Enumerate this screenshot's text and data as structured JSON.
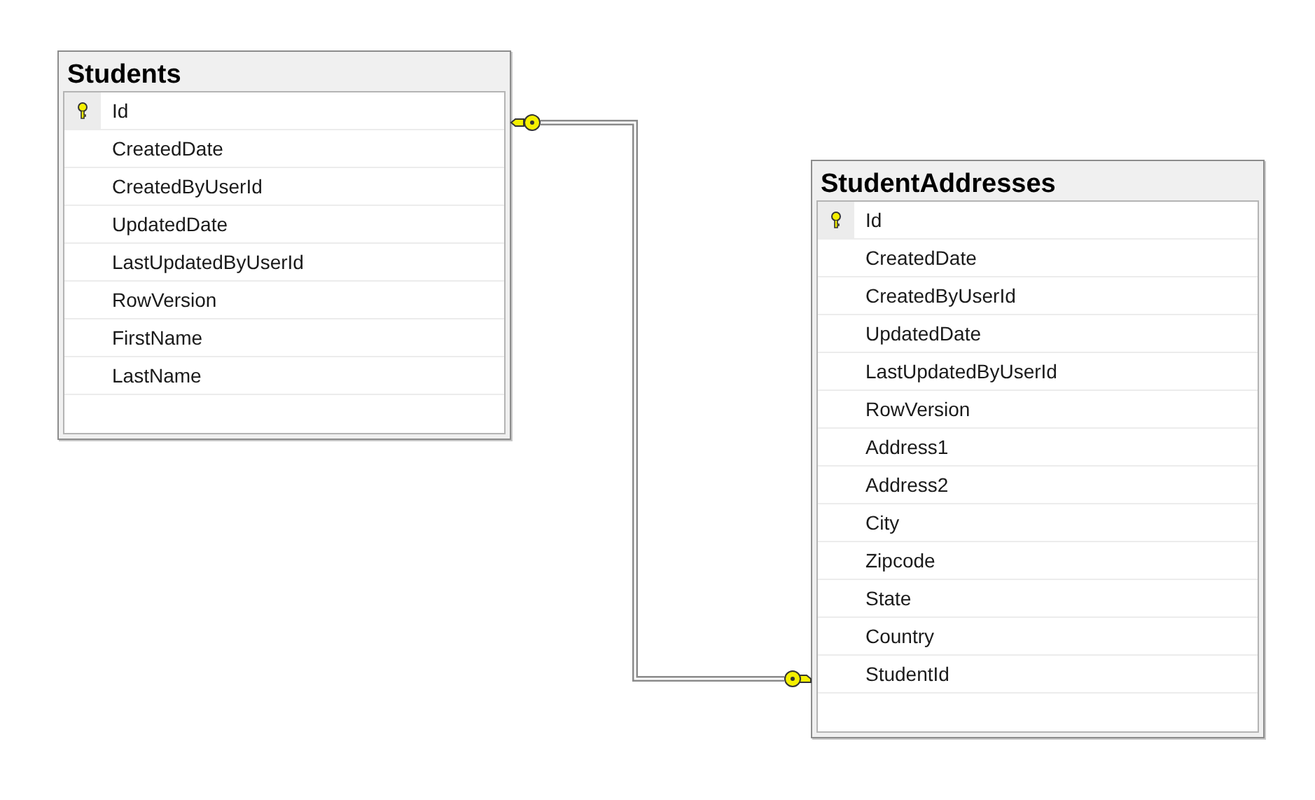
{
  "tables": [
    {
      "name": "Students",
      "columns": [
        {
          "name": "Id",
          "primary_key": true
        },
        {
          "name": "CreatedDate",
          "primary_key": false
        },
        {
          "name": "CreatedByUserId",
          "primary_key": false
        },
        {
          "name": "UpdatedDate",
          "primary_key": false
        },
        {
          "name": "LastUpdatedByUserId",
          "primary_key": false
        },
        {
          "name": "RowVersion",
          "primary_key": false
        },
        {
          "name": "FirstName",
          "primary_key": false
        },
        {
          "name": "LastName",
          "primary_key": false
        }
      ]
    },
    {
      "name": "StudentAddresses",
      "columns": [
        {
          "name": "Id",
          "primary_key": true
        },
        {
          "name": "CreatedDate",
          "primary_key": false
        },
        {
          "name": "CreatedByUserId",
          "primary_key": false
        },
        {
          "name": "UpdatedDate",
          "primary_key": false
        },
        {
          "name": "LastUpdatedByUserId",
          "primary_key": false
        },
        {
          "name": "RowVersion",
          "primary_key": false
        },
        {
          "name": "Address1",
          "primary_key": false
        },
        {
          "name": "Address2",
          "primary_key": false
        },
        {
          "name": "City",
          "primary_key": false
        },
        {
          "name": "Zipcode",
          "primary_key": false
        },
        {
          "name": "State",
          "primary_key": false
        },
        {
          "name": "Country",
          "primary_key": false
        },
        {
          "name": "StudentId",
          "primary_key": false
        }
      ]
    }
  ]
}
